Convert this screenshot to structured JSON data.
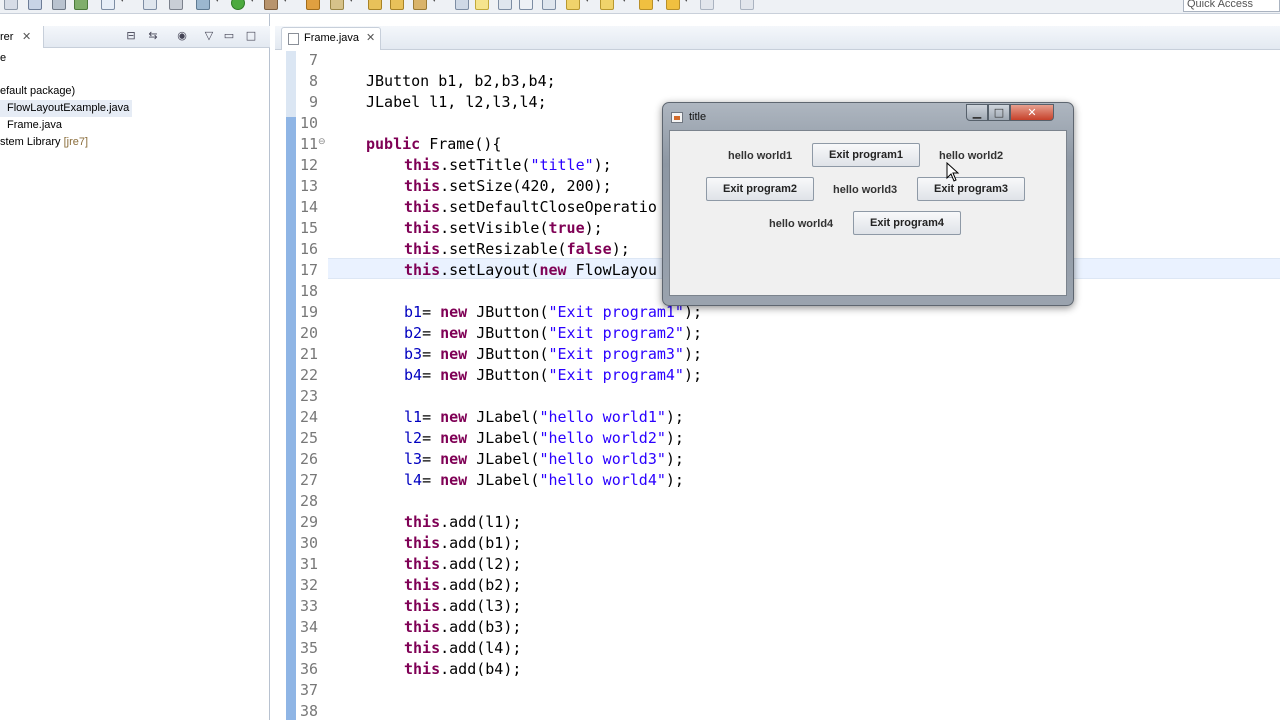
{
  "toolbar": {
    "quick_access": "Quick Access"
  },
  "explorer": {
    "tab_label": "rer",
    "tree": [
      {
        "label": "e"
      },
      {
        "label": "efault package)"
      },
      {
        "label": "FlowLayoutExample.java"
      },
      {
        "label": "Frame.java"
      },
      {
        "label": "stem Library",
        "tag": "[jre7]"
      }
    ]
  },
  "editor": {
    "tab_label": "Frame.java",
    "lines": [
      {
        "n": "7"
      },
      {
        "n": "8"
      },
      {
        "n": "9"
      },
      {
        "n": "10"
      },
      {
        "n": "11"
      },
      {
        "n": "12"
      },
      {
        "n": "13"
      },
      {
        "n": "14"
      },
      {
        "n": "15"
      },
      {
        "n": "16"
      },
      {
        "n": "17"
      },
      {
        "n": "18"
      },
      {
        "n": "19"
      },
      {
        "n": "20"
      },
      {
        "n": "21"
      },
      {
        "n": "22"
      },
      {
        "n": "23"
      },
      {
        "n": "24"
      },
      {
        "n": "25"
      },
      {
        "n": "26"
      },
      {
        "n": "27"
      },
      {
        "n": "28"
      },
      {
        "n": "29"
      },
      {
        "n": "30"
      },
      {
        "n": "31"
      },
      {
        "n": "32"
      },
      {
        "n": "33"
      },
      {
        "n": "34"
      },
      {
        "n": "35"
      },
      {
        "n": "36"
      },
      {
        "n": "37"
      },
      {
        "n": "38"
      }
    ],
    "code": {
      "l8": "JButton b1, b2,b3,b4;",
      "l9": "JLabel l1, l2,l3,l4;",
      "l11_kw": "public",
      "l11_rest": " Frame(){",
      "this": "this",
      "l12_a": ".setTitle(",
      "l12_s": "\"title\"",
      "l12_b": ");",
      "l13_a": ".setSize(420, 200);",
      "l14_a": ".setDefaultCloseOperatio",
      "l15_a": ".setVisible(",
      "l15_k": "true",
      "l15_b": ");",
      "l16_a": ".setResizable(",
      "l16_k": "false",
      "l16_b": ");",
      "l17_a": ".setLayout(",
      "l17_k": "new",
      "l17_b": " FlowLayou",
      "new": "new",
      "b_lines": [
        {
          "v": "b1",
          "s": "\"Exit program1\""
        },
        {
          "v": "b2",
          "s": "\"Exit program2\""
        },
        {
          "v": "b3",
          "s": "\"Exit program3\""
        },
        {
          "v": "b4",
          "s": "\"Exit program4\""
        }
      ],
      "jbutton_call": " JButton(",
      "l_lines": [
        {
          "v": "l1",
          "s": "\"hello world1\""
        },
        {
          "v": "l2",
          "s": "\"hello world2\""
        },
        {
          "v": "l3",
          "s": "\"hello world3\""
        },
        {
          "v": "l4",
          "s": "\"hello world4\""
        }
      ],
      "jlabel_call": " JLabel(",
      "assign": "= ",
      "close": ");",
      "add_lines": [
        "l1",
        "b1",
        "l2",
        "b2",
        "l3",
        "b3",
        "l4",
        "b4"
      ],
      "add_call": ".add(",
      "add_close": ");"
    }
  },
  "swing_window": {
    "title": "title",
    "labels": [
      "hello world1",
      "hello world2",
      "hello world3",
      "hello world4"
    ],
    "buttons": [
      "Exit program1",
      "Exit program2",
      "Exit program3",
      "Exit program4"
    ],
    "close_glyph": "✕",
    "min_glyph": "▁",
    "max_glyph": "□"
  },
  "colors": {
    "keyword": "#7f0055",
    "string": "#2a00ff",
    "field": "#0000c0",
    "line_number": "#787878"
  }
}
